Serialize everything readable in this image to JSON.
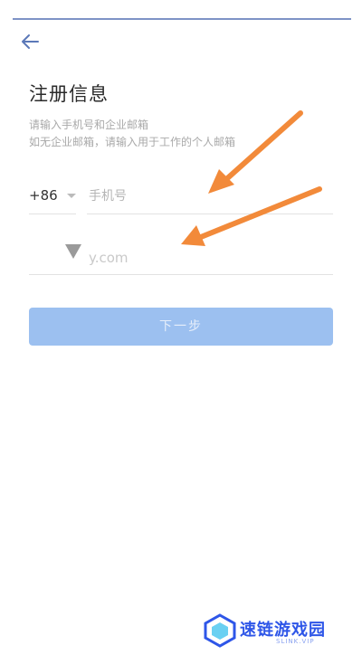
{
  "header": {
    "title": "注册信息"
  },
  "hints": {
    "line1": "请输入手机号和企业邮箱",
    "line2": "如无企业邮箱，请输入用于工作的个人邮箱"
  },
  "phone": {
    "country_code": "+86",
    "placeholder": "手机号"
  },
  "email": {
    "placeholder": "y.com"
  },
  "actions": {
    "next_label": "下一步"
  },
  "watermark": {
    "name": "速链游戏园",
    "sub": "SLINK.VIP"
  },
  "colors": {
    "accent_line": "#7e93c6",
    "next_button": "#9cc0f0",
    "annotation_arrow": "#f28a3a",
    "brand": "#2e56e8"
  }
}
